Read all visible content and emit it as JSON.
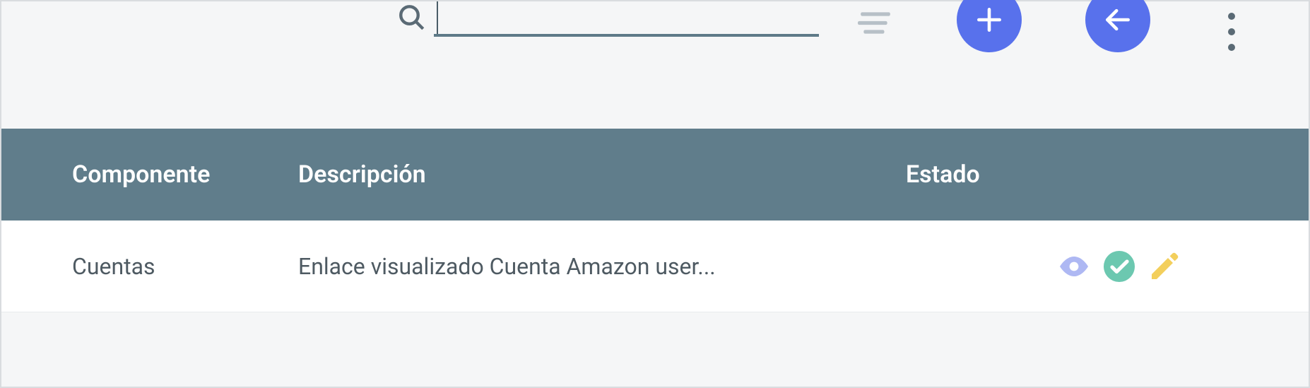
{
  "search": {
    "value": "",
    "placeholder": ""
  },
  "table": {
    "headers": {
      "componente": "Componente",
      "descripcion": "Descripción",
      "estado": "Estado"
    },
    "rows": [
      {
        "componente": "Cuentas",
        "descripcion": "Enlace visualizado Cuenta Amazon user..."
      }
    ]
  },
  "icons": {
    "search": "search-icon",
    "menu_lines": "menu-lines-icon",
    "add": "plus-icon",
    "back": "arrow-left-icon",
    "more": "more-vertical-icon",
    "eye": "eye-icon",
    "check": "check-circle-icon",
    "pencil": "pencil-icon"
  },
  "colors": {
    "accent": "#5871ec",
    "header": "#607d8b",
    "eye": "#aeb8f3",
    "check": "#6cc8b0",
    "pencil": "#f3cf5c"
  }
}
